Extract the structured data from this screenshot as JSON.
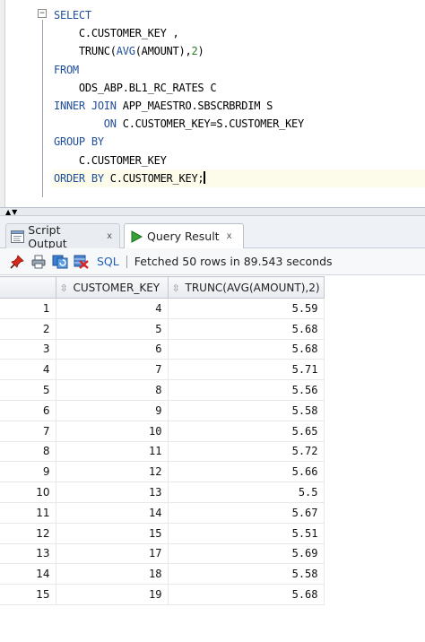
{
  "editor": {
    "fold_symbol": "−",
    "lines": [
      [
        {
          "t": "kw",
          "v": "SELECT"
        }
      ],
      [
        {
          "t": "ident",
          "v": "    C.CUSTOMER_KEY ,"
        }
      ],
      [
        {
          "t": "ident",
          "v": "    TRUNC("
        },
        {
          "t": "func",
          "v": "AVG"
        },
        {
          "t": "ident",
          "v": "(AMOUNT),"
        },
        {
          "t": "num",
          "v": "2"
        },
        {
          "t": "ident",
          "v": ")"
        }
      ],
      [
        {
          "t": "kw",
          "v": "FROM"
        }
      ],
      [
        {
          "t": "ident",
          "v": "    ODS_ABP.BL1_RC_RATES C"
        }
      ],
      [
        {
          "t": "kw",
          "v": "INNER JOIN"
        },
        {
          "t": "ident",
          "v": " APP_MAESTRO.SBSCRBRDIM S"
        }
      ],
      [
        {
          "t": "ident",
          "v": "        "
        },
        {
          "t": "kw",
          "v": "ON"
        },
        {
          "t": "ident",
          "v": " C.CUSTOMER_KEY=S.CUSTOMER_KEY"
        }
      ],
      [
        {
          "t": "kw",
          "v": "GROUP BY"
        }
      ],
      [
        {
          "t": "ident",
          "v": "    C.CUSTOMER_KEY"
        }
      ],
      [
        {
          "t": "kw",
          "v": "ORDER BY"
        },
        {
          "t": "ident",
          "v": " C.CUSTOMER_KEY;"
        }
      ]
    ],
    "current_line": 9
  },
  "splitter": {
    "arrows": "▲▼"
  },
  "tabs": [
    {
      "label": "Script Output",
      "close": "x",
      "active": false
    },
    {
      "label": "Query Result",
      "close": "x",
      "active": true
    }
  ],
  "toolbar": {
    "sql_label": "SQL",
    "status": "Fetched 50 rows in 89.543 seconds",
    "icons": [
      "pin-icon",
      "print-icon",
      "refresh-icon",
      "delete-icon"
    ]
  },
  "grid": {
    "sort_glyph": "⇳",
    "columns": [
      "",
      "CUSTOMER_KEY",
      "TRUNC(AVG(AMOUNT),2)"
    ],
    "rows": [
      [
        "1",
        "4",
        "5.59"
      ],
      [
        "2",
        "5",
        "5.68"
      ],
      [
        "3",
        "6",
        "5.68"
      ],
      [
        "4",
        "7",
        "5.71"
      ],
      [
        "5",
        "8",
        "5.56"
      ],
      [
        "6",
        "9",
        "5.58"
      ],
      [
        "7",
        "10",
        "5.65"
      ],
      [
        "8",
        "11",
        "5.72"
      ],
      [
        "9",
        "12",
        "5.66"
      ],
      [
        "10",
        "13",
        "5.5"
      ],
      [
        "11",
        "14",
        "5.67"
      ],
      [
        "12",
        "15",
        "5.51"
      ],
      [
        "13",
        "17",
        "5.69"
      ],
      [
        "14",
        "18",
        "5.58"
      ],
      [
        "15",
        "19",
        "5.68"
      ]
    ]
  },
  "colors": {
    "keyword": "#1f4e9c",
    "number": "#2a7a2a",
    "current_line_bg": "#fdfbe9",
    "tab_active_bg": "#ffffff",
    "query_result_icon": "#2e9b2e"
  }
}
